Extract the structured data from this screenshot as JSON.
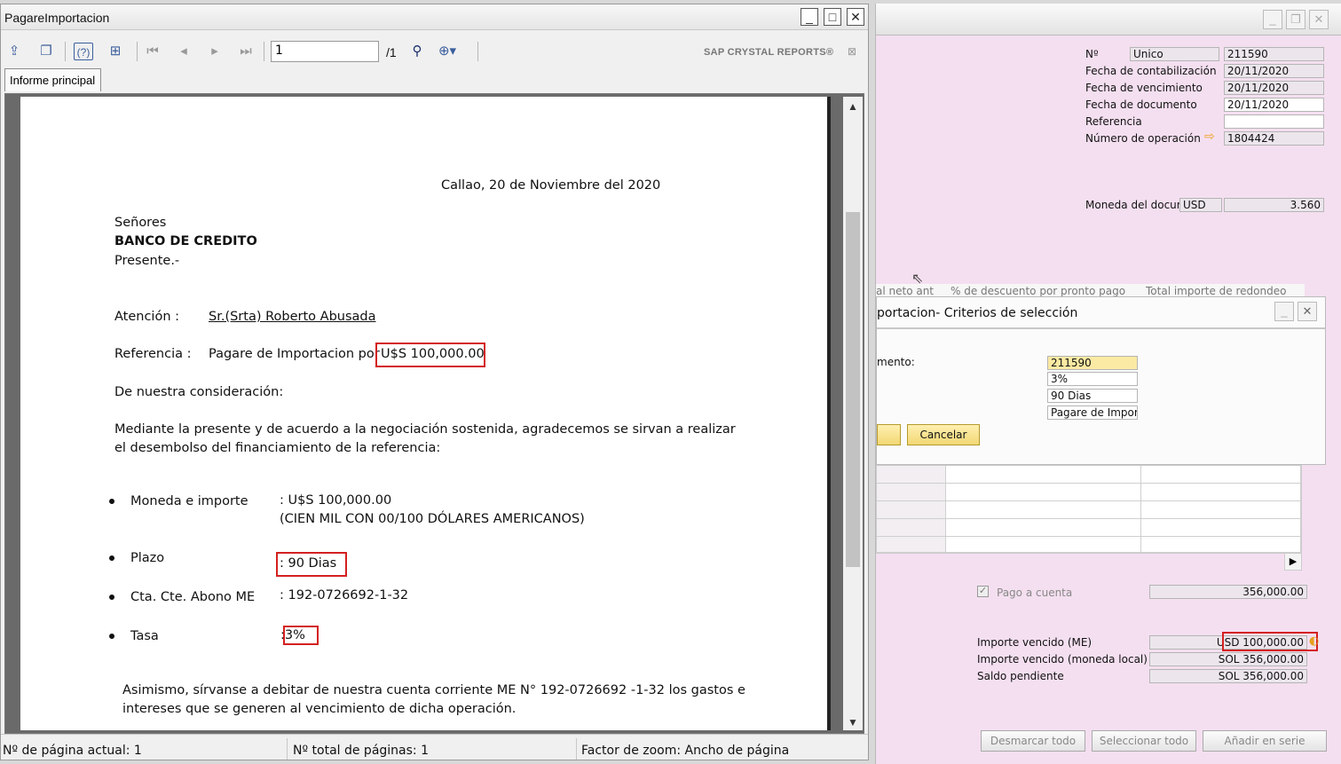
{
  "crystal": {
    "title": "PagareImportacion",
    "toolbar": {
      "page_value": "1",
      "page_total": "/1",
      "logo": "SAP CRYSTAL REPORTS®"
    },
    "tab": "Informe principal",
    "doc": {
      "date_line": "Callao, 20 de Noviembre del 2020",
      "salutation": "Señores",
      "bank": "BANCO DE CREDITO",
      "presente": "Presente.-",
      "attention_label": "Atención   :",
      "attention_value": "Sr.(Srta) Roberto Abusada",
      "reference_label": "Referencia :",
      "reference_value": "Pagare de Importacion por",
      "reference_amount": "U$S 100,000.00",
      "consideration": "De nuestra consideración:",
      "body1": "Mediante la presente y de acuerdo a la negociación sostenida, agradecemos se sirvan a realizar",
      "body2": "el desembolso del financiamiento de la referencia:",
      "items": [
        {
          "label": "Moneda e importe",
          "value": ": U$S 100,000.00",
          "extra": "(CIEN MIL CON  00/100 DÓLARES AMERICANOS)"
        },
        {
          "label": "Plazo",
          "value": ": 90 Dias"
        },
        {
          "label": "Cta. Cte. Abono ME",
          "value": ": 192-0726692-1-32"
        },
        {
          "label": "Tasa",
          "value": ":3%"
        }
      ],
      "closing1": "Asimismo, sírvanse a debitar de nuestra cuenta corriente ME N° 192-0726692 -1-32 los gastos e",
      "closing2": "intereses que se generen al vencimiento de dicha operación."
    },
    "status": {
      "current_page": "Nº de página actual: 1",
      "total_pages": "Nº total de páginas: 1",
      "zoom": "Factor de zoom: Ancho de página"
    }
  },
  "sap": {
    "header": {
      "no_label": "Nº",
      "no_series": "Unico",
      "no_value": "211590",
      "fecha_cont_label": "Fecha de contabilización",
      "fecha_cont": "20/11/2020",
      "fecha_venc_label": "Fecha de vencimiento",
      "fecha_venc": "20/11/2020",
      "fecha_doc_label": "Fecha de documento",
      "fecha_doc": "20/11/2020",
      "referencia_label": "Referencia",
      "referencia": "",
      "num_op_label": "Número de operación",
      "num_op": "1804424",
      "moneda_label": "Moneda del docum",
      "moneda": "USD",
      "tipo_cambio": "3.560"
    },
    "grid_headers": [
      "al neto ant",
      "% de descuento por pronto pago",
      "Total importe de redondeo"
    ],
    "dialog": {
      "title": "portacion- Criterios de selección",
      "field_label": "mento:",
      "fields": [
        "211590",
        "3%",
        "90 Dias",
        "Pagare de Import"
      ],
      "cancel": "Cancelar"
    },
    "footer": {
      "pago_cuenta_label": "Pago a cuenta",
      "pago_cuenta": "356,000.00",
      "imp_venc_me_label": "Importe vencido (ME)",
      "imp_venc_me": "USD 100,000.00",
      "imp_venc_ml_label": "Importe vencido (moneda local)",
      "imp_venc_ml": "SOL 356,000.00",
      "saldo_label": "Saldo pendiente",
      "saldo": "SOL 356,000.00"
    },
    "buttons": {
      "desmarcar": "Desmarcar todo",
      "seleccionar": "Seleccionar todo",
      "anadir": "Añadir en serie"
    }
  }
}
